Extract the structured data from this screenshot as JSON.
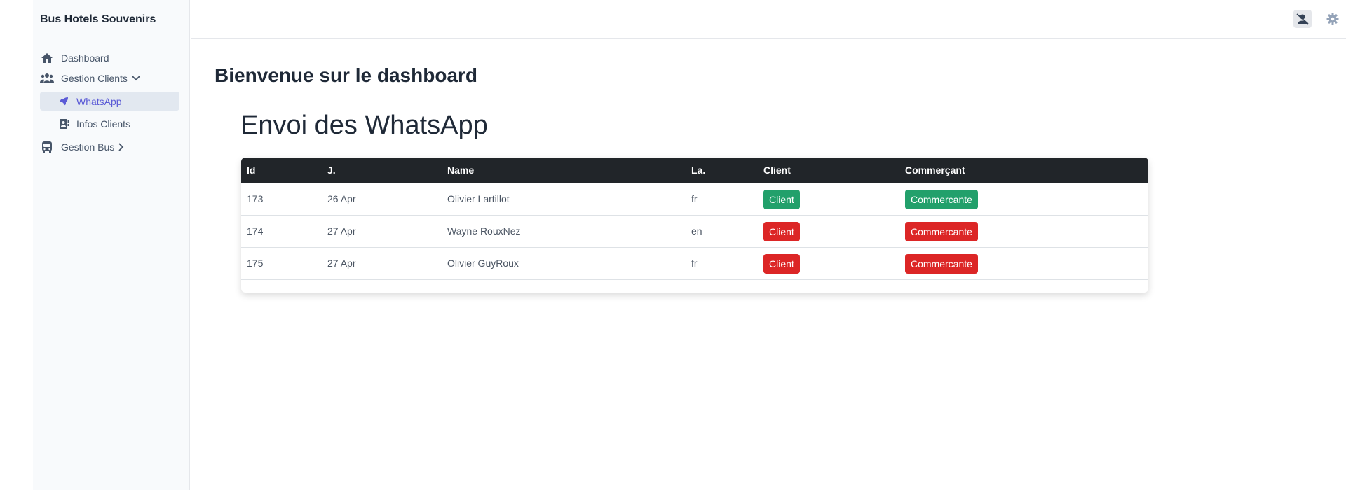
{
  "app": {
    "title": "Bus Hotels Souvenirs"
  },
  "sidebar": {
    "items": [
      {
        "label": "Dashboard",
        "icon": "home-icon"
      },
      {
        "label": "Gestion Clients",
        "icon": "users-icon",
        "expanded": true,
        "children": [
          {
            "label": "WhatsApp",
            "icon": "rocket-icon",
            "active": true
          },
          {
            "label": "Infos Clients",
            "icon": "contact-card-icon",
            "active": false
          }
        ]
      },
      {
        "label": "Gestion Bus",
        "icon": "bus-icon",
        "expanded": false
      }
    ]
  },
  "topbar": {
    "icons": [
      "user-slash-icon",
      "gear-icon"
    ]
  },
  "main": {
    "page_title": "Bienvenue sur le dashboard",
    "section_title": "Envoi des WhatsApp",
    "table": {
      "columns": [
        "Id",
        "J.",
        "Name",
        "La.",
        "Client",
        "Commerçant"
      ],
      "rows": [
        {
          "id": "173",
          "day": "26 Apr",
          "name": "Olivier Lartillot",
          "lang": "fr",
          "client_label": "Client",
          "client_status": "sent",
          "commercant_label": "Commercante",
          "commercant_status": "sent"
        },
        {
          "id": "174",
          "day": "27 Apr",
          "name": "Wayne RouxNez",
          "lang": "en",
          "client_label": "Client",
          "client_status": "pending",
          "commercant_label": "Commercante",
          "commercant_status": "pending"
        },
        {
          "id": "175",
          "day": "27 Apr",
          "name": "Olivier GuyRoux",
          "lang": "fr",
          "client_label": "Client",
          "client_status": "pending",
          "commercant_label": "Commercante",
          "commercant_status": "pending"
        }
      ]
    }
  },
  "colors": {
    "accent": "#5b5bd6",
    "success": "#22a06b",
    "danger": "#dc2626",
    "table_header": "#212529",
    "sidebar_bg": "#f8fafc"
  }
}
